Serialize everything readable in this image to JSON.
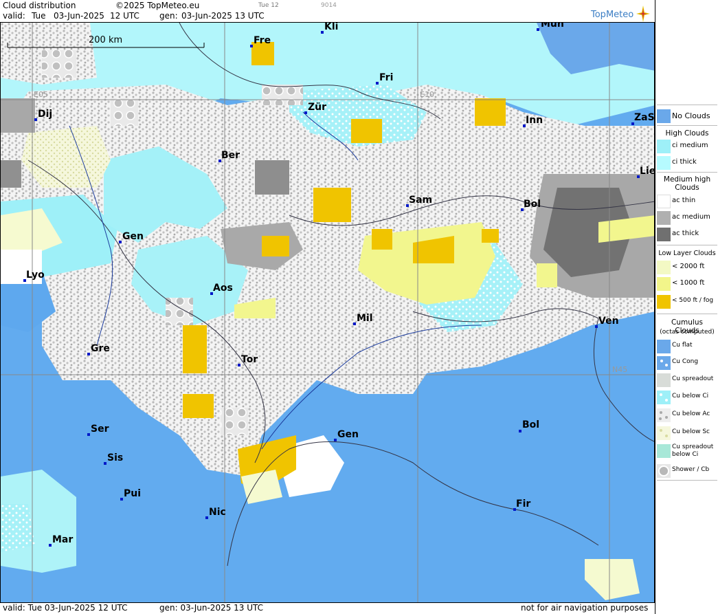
{
  "header": {
    "title": "Cloud distribution",
    "copyright": "©2025 TopMeteo.eu",
    "valid_label": "valid:",
    "valid_day": "Tue",
    "valid_date": "03-Jun-2025",
    "valid_time": "12 UTC",
    "gen_label": "gen:",
    "gen_value": "03-Jun-2025 13 UTC",
    "tab_small": "Tue 12",
    "code_small": "9014",
    "logo": "TopMeteo"
  },
  "map": {
    "scale_label": "200 km",
    "grid_labels": [
      "E05",
      "E10",
      "N45"
    ],
    "cities": [
      "Fre",
      "Kli",
      "Mün",
      "Fri",
      "Dij",
      "Zür",
      "Inn",
      "ZaS",
      "Ber",
      "Lie",
      "Sam",
      "Bol",
      "Gen",
      "Lyo",
      "Aos",
      "Mil",
      "Ven",
      "Gre",
      "Tor",
      "Ser",
      "Gen",
      "Bol",
      "Sis",
      "Pui",
      "Nic",
      "Fir",
      "Mar"
    ]
  },
  "footer": {
    "valid": "valid:  Tue  03-Jun-2025  12 UTC",
    "gen": "gen: 03-Jun-2025 13 UTC",
    "note": "not for air navigation purposes"
  },
  "legend": {
    "no_clouds": "No Clouds",
    "high_head": "High Clouds",
    "ci_medium": "ci medium",
    "ci_thick": "ci thick",
    "med_head": "Medium high Clouds",
    "ac_thin": "ac thin",
    "ac_medium": "ac medium",
    "ac_thick": "ac thick",
    "low_head": "Low Layer Clouds",
    "lt2000": "< 2000 ft",
    "lt1000": "< 1000 ft",
    "lt500": "< 500 ft / fog",
    "cu_head": "Cumulus Clouds",
    "cu_sub": "(octas computed)",
    "cu_flat": "Cu flat",
    "cu_cong": "Cu Cong",
    "cu_spread": "Cu spreadout",
    "cu_below_ci": "Cu below Ci",
    "cu_below_ac": "Cu below Ac",
    "cu_below_sc": "Cu below Sc",
    "cu_spread_ci": "Cu spreadout below Ci",
    "shower": "Shower / Cb"
  },
  "colors": {
    "sea": "#5ea8ee",
    "no_clouds": "#6aa8ea",
    "ci_medium": "#9ef0f8",
    "ci_thick": "#b6fbff",
    "ac_medium": "#b0b0b0",
    "ac_thick": "#707070",
    "low_2000": "#f3f9c4",
    "low_1000": "#f2f58a",
    "fog": "#f0c400"
  }
}
